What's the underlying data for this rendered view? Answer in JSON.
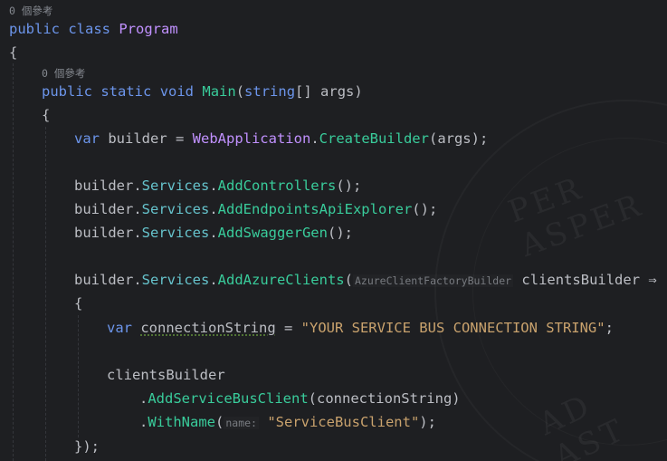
{
  "hints": {
    "refs_class": "0 個參考",
    "refs_main": "0 個參考"
  },
  "code": {
    "l1_kw1": "public",
    "l1_kw2": "class",
    "l1_name": "Program",
    "l2": "{",
    "l3_kw1": "public",
    "l3_kw2": "static",
    "l3_kw3": "void",
    "l3_name": "Main",
    "l3_open": "(",
    "l3_type": "string",
    "l3_rest": "[] args)",
    "l4": "{",
    "l5_kw": "var",
    "l5_a": " builder = ",
    "l5_cls": "WebApplication",
    "l5_dot": ".",
    "l5_meth": "CreateBuilder",
    "l5_end": "(args);",
    "l7_a": "builder.",
    "l7_prop": "Services",
    "l7_dot": ".",
    "l7_meth": "AddControllers",
    "l7_end": "();",
    "l8_a": "builder.",
    "l8_prop": "Services",
    "l8_dot": ".",
    "l8_meth": "AddEndpointsApiExplorer",
    "l8_end": "();",
    "l9_a": "builder.",
    "l9_prop": "Services",
    "l9_dot": ".",
    "l9_meth": "AddSwaggerGen",
    "l9_end": "();",
    "l11_a": "builder.",
    "l11_prop": "Services",
    "l11_dot": ".",
    "l11_meth": "AddAzureClients",
    "l11_open": "(",
    "l11_inlay": "AzureClientFactoryBuilder",
    "l11_end": " clientsBuilder ⇒",
    "l12": "{",
    "l13_kw": "var",
    "l13_sp": " ",
    "l13_var": "connectionString",
    "l13_eq": " = ",
    "l13_str": "\"YOUR SERVICE BUS CONNECTION STRING\"",
    "l13_end": ";",
    "l15": "clientsBuilder",
    "l16_dot": ".",
    "l16_meth": "AddServiceBusClient",
    "l16_end": "(connectionString)",
    "l17_dot": ".",
    "l17_meth": "WithName",
    "l17_open": "(",
    "l17_inlay": "name:",
    "l17_str": "\"ServiceBusClient\"",
    "l17_end": ");",
    "l18": "});"
  },
  "colors": {
    "background": "#1e1f22",
    "keyword": "#6c95eb",
    "class_name": "#c191ff",
    "method": "#39cc9b",
    "property": "#66c3cc",
    "string": "#c9a26d",
    "text": "#bcbec4"
  }
}
